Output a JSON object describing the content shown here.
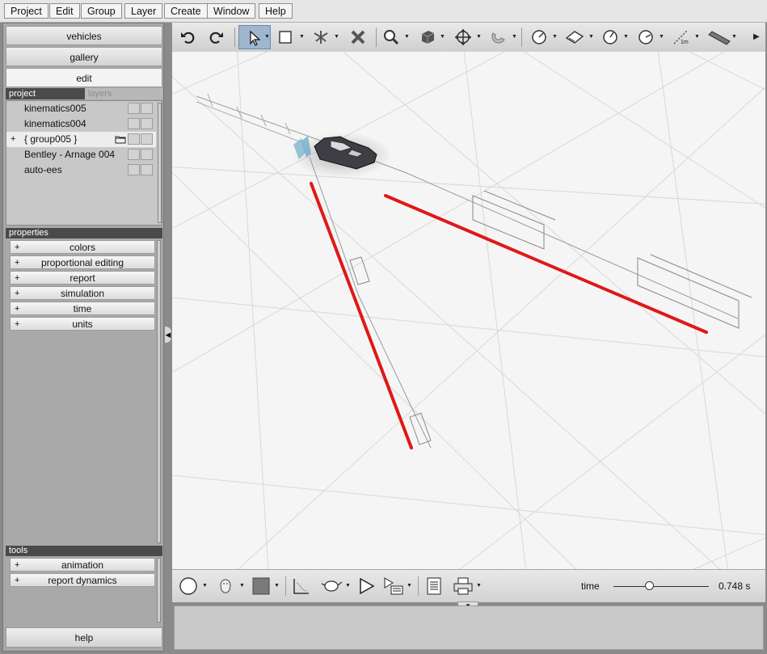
{
  "menu": [
    "Project",
    "Edit",
    "Group",
    "Layer",
    "Create",
    "Window",
    "Help"
  ],
  "left_nav": {
    "vehicles": "vehicles",
    "gallery": "gallery",
    "edit": "edit",
    "help": "help"
  },
  "tabs": {
    "project": "project",
    "layers": "layers"
  },
  "project_items": [
    {
      "label": "kinematics005",
      "expand": ""
    },
    {
      "label": "kinematics004",
      "expand": ""
    },
    {
      "label": "{ group005 }",
      "expand": "+"
    },
    {
      "label": "Bentley - Arnage 004",
      "expand": ""
    },
    {
      "label": "auto-ees",
      "expand": ""
    }
  ],
  "properties": {
    "header": "properties",
    "items": [
      "colors",
      "proportional editing",
      "report",
      "simulation",
      "time",
      "units"
    ]
  },
  "tools": {
    "header": "tools",
    "items": [
      "animation",
      "report dynamics"
    ]
  },
  "toolbar_icons": [
    "undo-icon",
    "redo-icon",
    "select-arrow-icon",
    "rectangle-icon",
    "transform-icon",
    "delete-x-icon",
    "zoom-icon",
    "cube-view-icon",
    "move-icon",
    "magnet-icon",
    "measure-circle-icon",
    "surface-icon",
    "angle-icon",
    "angle2-icon",
    "distance-1m-icon",
    "ruler-icon"
  ],
  "scale_label": "1m",
  "timebar": {
    "label": "time",
    "value": "0.748 s",
    "fraction": 0.38
  },
  "colors": {
    "accent": "#9fb6cf",
    "trajectory_red": "#e01818"
  }
}
